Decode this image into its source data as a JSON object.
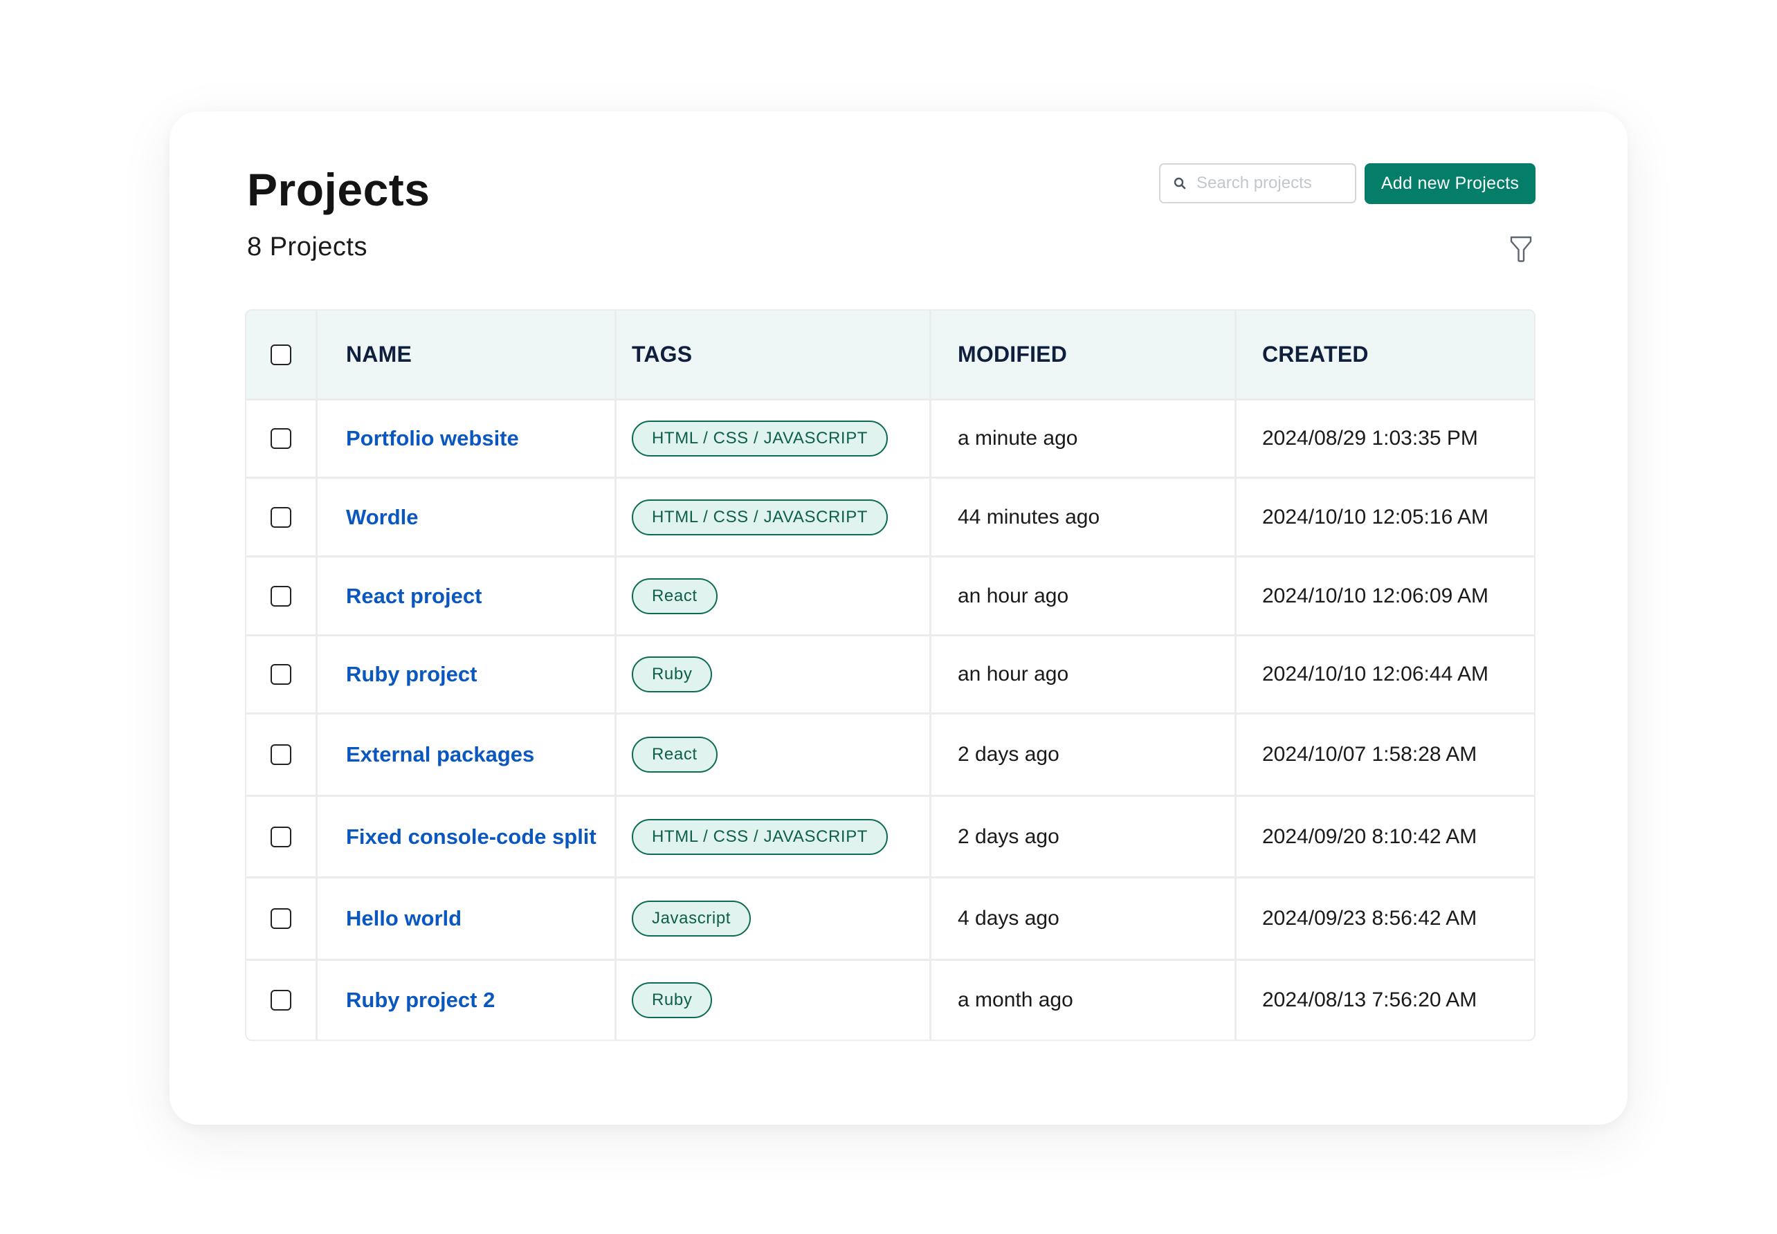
{
  "page": {
    "title": "Projects",
    "count_label": "8 Projects"
  },
  "toolbar": {
    "search_placeholder": "Search projects",
    "search_value": "",
    "add_button_label": "Add new Projects",
    "search_icon": "search-icon",
    "filter_icon": "filter-icon"
  },
  "colors": {
    "primary": "#047e68",
    "link": "#0b57c0",
    "header_bg": "#eef7f5",
    "tag_border": "#0d6b55",
    "tag_bg": "#e1f3ee"
  },
  "table": {
    "columns": [
      "NAME",
      "TAGS",
      "MODIFIED",
      "CREATED"
    ],
    "rows": [
      {
        "name": "Portfolio website",
        "tag": "HTML / CSS / JAVASCRIPT",
        "modified": "a minute ago",
        "created": "2024/08/29 1:03:35 PM",
        "checked": false
      },
      {
        "name": "Wordle",
        "tag": "HTML / CSS / JAVASCRIPT",
        "modified": "44 minutes ago",
        "created": "2024/10/10 12:05:16 AM",
        "checked": false
      },
      {
        "name": "React project",
        "tag": "React",
        "modified": "an hour ago",
        "created": "2024/10/10 12:06:09 AM",
        "checked": false
      },
      {
        "name": "Ruby project",
        "tag": "Ruby",
        "modified": "an hour ago",
        "created": "2024/10/10 12:06:44 AM",
        "checked": false
      },
      {
        "name": "External packages",
        "tag": "React",
        "modified": "2 days ago",
        "created": "2024/10/07 1:58:28 AM",
        "checked": false
      },
      {
        "name": "Fixed console-code split",
        "tag": "HTML / CSS / JAVASCRIPT",
        "modified": "2 days ago",
        "created": "2024/09/20 8:10:42 AM",
        "checked": false
      },
      {
        "name": "Hello world",
        "tag": "Javascript",
        "modified": "4 days ago",
        "created": "2024/09/23 8:56:42 AM",
        "checked": false
      },
      {
        "name": "Ruby project 2",
        "tag": "Ruby",
        "modified": "a month ago",
        "created": "2024/08/13 7:56:20 AM",
        "checked": false
      }
    ]
  }
}
